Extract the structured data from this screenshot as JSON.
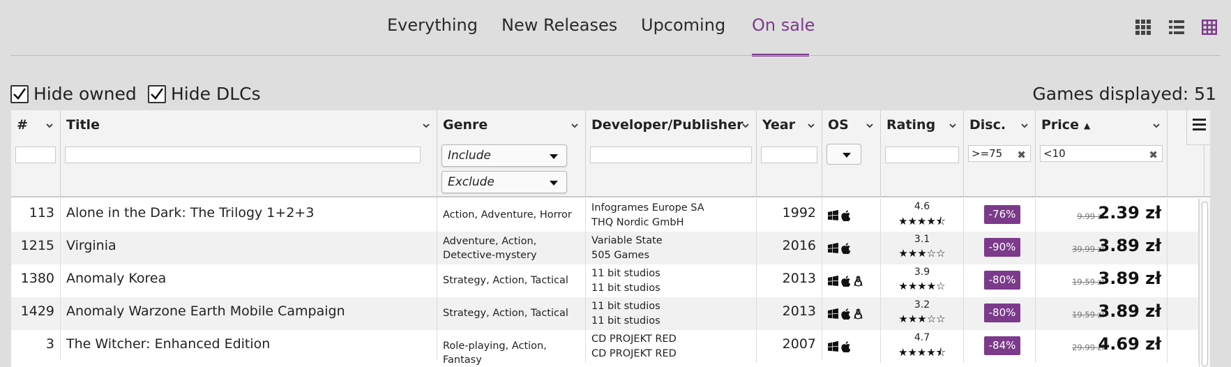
{
  "nav": {
    "tabs": [
      {
        "label": "Everything",
        "active": false
      },
      {
        "label": "New Releases",
        "active": false
      },
      {
        "label": "Upcoming",
        "active": false
      },
      {
        "label": "On sale",
        "active": true
      }
    ],
    "view_icons": [
      "grid-view-icon",
      "list-view-icon",
      "table-view-icon"
    ]
  },
  "filters": {
    "hide_owned": {
      "label": "Hide owned",
      "checked": true
    },
    "hide_dlcs": {
      "label": "Hide DLCs",
      "checked": true
    },
    "games_displayed": "Games displayed: 51"
  },
  "columns": {
    "num": "#",
    "title": "Title",
    "genre": "Genre",
    "developer": "Developer/Publisher",
    "year": "Year",
    "os": "OS",
    "rating": "Rating",
    "discount": "Disc.",
    "price": "Price"
  },
  "column_filters": {
    "genre_include": "Include",
    "genre_exclude": "Exclude",
    "discount_value": ">=75",
    "price_value": "<10"
  },
  "rows": [
    {
      "num": "113",
      "title": "Alone in the Dark: The Trilogy 1+2+3",
      "genre": "Action, Adventure, Horror",
      "developer": "Infogrames Europe SA",
      "publisher": "THQ Nordic GmbH",
      "year": "1992",
      "os": [
        "windows",
        "mac"
      ],
      "rating": "4.6",
      "stars": "★★★★⯪",
      "discount": "-76%",
      "old_price": "9.99 zł",
      "price": "2.39 zł"
    },
    {
      "num": "1215",
      "title": "Virginia",
      "genre": "Adventure, Action, Detective-mystery",
      "developer": "Variable State",
      "publisher": "505 Games",
      "year": "2016",
      "os": [
        "windows",
        "mac"
      ],
      "rating": "3.1",
      "stars": "★★★☆☆",
      "discount": "-90%",
      "old_price": "39.99 zł",
      "price": "3.89 zł"
    },
    {
      "num": "1380",
      "title": "Anomaly Korea",
      "genre": "Strategy, Action, Tactical",
      "developer": "11 bit studios",
      "publisher": "11 bit studios",
      "year": "2013",
      "os": [
        "windows",
        "mac",
        "linux"
      ],
      "rating": "3.9",
      "stars": "★★★★☆",
      "discount": "-80%",
      "old_price": "19.59 zł",
      "price": "3.89 zł"
    },
    {
      "num": "1429",
      "title": "Anomaly Warzone Earth Mobile Campaign",
      "genre": "Strategy, Action, Tactical",
      "developer": "11 bit studios",
      "publisher": "11 bit studios",
      "year": "2013",
      "os": [
        "windows",
        "mac",
        "linux"
      ],
      "rating": "3.2",
      "stars": "★★★☆☆",
      "discount": "-80%",
      "old_price": "19.59 zł",
      "price": "3.89 zł"
    },
    {
      "num": "3",
      "title": "The Witcher: Enhanced Edition",
      "genre": "Role-playing, Action, Fantasy",
      "developer": "CD PROJEKT RED",
      "publisher": "CD PROJEKT RED",
      "year": "2007",
      "os": [
        "windows",
        "mac"
      ],
      "rating": "4.7",
      "stars": "★★★★⯪",
      "discount": "-84%",
      "old_price": "29.99 zł",
      "price": "4.69 zł"
    }
  ],
  "colors": {
    "accent": "#7b3a8a",
    "background": "#dedede",
    "row_alt": "#f1f1f1"
  }
}
